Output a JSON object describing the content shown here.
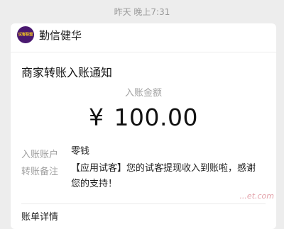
{
  "timestamp": "昨天 晚上7:31",
  "brand": {
    "logo_text": "试客联盟",
    "name": "勤信健华"
  },
  "notice": {
    "title": "商家转账入账通知",
    "amount_label": "入账金额",
    "currency": "¥",
    "amount": "100.00"
  },
  "rows": [
    {
      "label": "入账账户",
      "value": "零钱"
    },
    {
      "label": "转账备注",
      "value": "【应用试客】您的试客提现收入到账啦，感谢您的支持！"
    }
  ],
  "details_label": "账单详情",
  "watermark": "...et.com"
}
